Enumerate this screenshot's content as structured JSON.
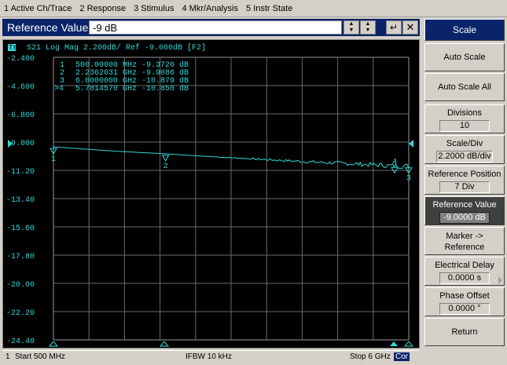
{
  "menu": [
    "1 Active Ch/Trace",
    "2 Response",
    "3 Stimulus",
    "4 Mkr/Analysis",
    "5 Instr State"
  ],
  "entry": {
    "label": "Reference Value",
    "value": "-9 dB"
  },
  "trace_header": {
    "tag": "Tr2",
    "text": "S21  Log Mag 2.200dB/ Ref -9.000dB [F2]"
  },
  "marker_table": [
    {
      "id": "1",
      "value": "500.00000 MHz -9.3726 dB"
    },
    {
      "id": "2",
      "value": "2.2362031 GHz -9.9086 dB"
    },
    {
      "id": "3",
      "value": "6.0000000 GHz -10.879 dB"
    },
    {
      "id": ">4",
      "value": "5.7814570 GHz -10.850 dB"
    }
  ],
  "y_ticks": [
    "-2.400",
    "-4.600",
    "-6.800",
    "-9.000",
    "-11.20",
    "-13.40",
    "-15.60",
    "-17.80",
    "-20.00",
    "-22.20",
    "-24.40"
  ],
  "status": {
    "channel": "1",
    "start": "Start 500 MHz",
    "ifbw": "IFBW 10 kHz",
    "stop": "Stop 6 GHz",
    "cor": "Cor"
  },
  "softkeys": {
    "title": "Scale",
    "auto_scale": "Auto Scale",
    "auto_scale_all": "Auto Scale All",
    "divisions": {
      "label": "Divisions",
      "value": "10"
    },
    "scale_div": {
      "label": "Scale/Div",
      "value": "2.2000 dB/div"
    },
    "ref_pos": {
      "label": "Reference Position",
      "value": "7 Div"
    },
    "ref_val": {
      "label": "Reference Value",
      "value": "-9.0000 dB"
    },
    "marker_ref": {
      "line1": "Marker ->",
      "line2": "Reference"
    },
    "elec_delay": {
      "label": "Electrical Delay",
      "value": "0.0000 s"
    },
    "phase_offset": {
      "label": "Phase Offset",
      "value": "0.0000 °"
    },
    "return": "Return"
  },
  "chart_data": {
    "type": "line",
    "x_unit": "GHz",
    "y_unit": "dB",
    "xlim": [
      0.5,
      6.0
    ],
    "ylim": [
      -24.4,
      -2.4
    ],
    "reference_level": -9.0,
    "grid": true,
    "trace_color": "#33d6d6",
    "x": [
      0.5,
      1.0,
      1.5,
      2.0,
      2.236,
      2.5,
      3.0,
      3.5,
      4.0,
      4.5,
      5.0,
      5.5,
      5.78,
      6.0
    ],
    "y": [
      -9.37,
      -9.55,
      -9.72,
      -9.85,
      -9.91,
      -10.0,
      -10.15,
      -10.28,
      -10.42,
      -10.55,
      -10.66,
      -10.78,
      -10.85,
      -10.88
    ],
    "markers": [
      {
        "label": "1",
        "x": 0.5,
        "y": -9.3726
      },
      {
        "label": "2",
        "x": 2.2362031,
        "y": -9.9086
      },
      {
        "label": "3",
        "x": 6.0,
        "y": -10.879
      },
      {
        "label": "4",
        "x": 5.781457,
        "y": -10.85
      }
    ]
  }
}
